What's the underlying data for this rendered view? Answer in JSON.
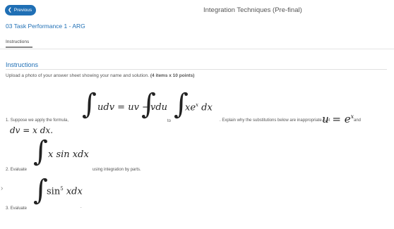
{
  "header": {
    "back_label": "Previous",
    "title": "Integration Techniques (Pre-final)"
  },
  "task": {
    "title": "03 Task Performance 1 - ARG",
    "tab": "Instructions"
  },
  "instructions": {
    "heading": "Instructions",
    "subtitle_prefix": "Upload a photo of your answer sheet showing your name and solution. ",
    "subtitle_bold": "(4 items x 10 points)"
  },
  "items": {
    "q1": {
      "prefix": "1. Suppose we apply the formula,",
      "formula": "udv = uv −",
      "formula_b": "vdu",
      "to": "to",
      "integrand": "xe",
      "integrand_exp": "x",
      "integrand_dx": "dx",
      "explain": ". Explain why the substitutions below are inappropriate. Let",
      "u_lhs": "u = e",
      "u_exp": "x",
      "and": "and",
      "dv": "dv = x dx",
      "period": "."
    },
    "q2": {
      "prefix": "2. Evaluate",
      "integrand": "x sin  xdx",
      "suffix": "using integration by parts."
    },
    "q3": {
      "prefix": "3. Evaluate",
      "integrand_a": "sin",
      "integrand_exp": "5",
      "integrand_b": "xdx",
      "suffix": "."
    }
  },
  "icons": {
    "back": "chevron-left-icon",
    "side": "chevron-right-icon"
  }
}
